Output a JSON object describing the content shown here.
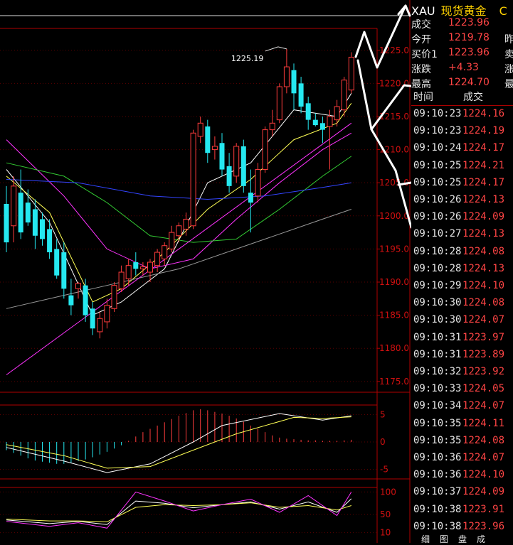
{
  "quote": {
    "symbol": "XAU",
    "name": "现货黄金",
    "extra": "C",
    "rows": [
      {
        "label": "成交",
        "value": "1223.96",
        "right": ""
      },
      {
        "label": "今开",
        "value": "1219.78",
        "right": "昨"
      },
      {
        "label": "买价1",
        "value": "1223.96",
        "right": "卖"
      },
      {
        "label": "涨跌",
        "value": "+4.33",
        "right": "涨"
      },
      {
        "label": "最高",
        "value": "1224.70",
        "right": "最"
      }
    ]
  },
  "ticks": {
    "col_time": "时间",
    "col_price": "成交",
    "rows": [
      {
        "time": "09:10:23",
        "price": "1224.16"
      },
      {
        "time": "09:10:23",
        "price": "1224.19"
      },
      {
        "time": "09:10:24",
        "price": "1224.17"
      },
      {
        "time": "09:10:25",
        "price": "1224.21"
      },
      {
        "time": "09:10:25",
        "price": "1224.17"
      },
      {
        "time": "09:10:26",
        "price": "1224.13"
      },
      {
        "time": "09:10:26",
        "price": "1224.09"
      },
      {
        "time": "09:10:27",
        "price": "1224.13"
      },
      {
        "time": "09:10:28",
        "price": "1224.08"
      },
      {
        "time": "09:10:28",
        "price": "1224.13"
      },
      {
        "time": "09:10:29",
        "price": "1224.10"
      },
      {
        "time": "09:10:30",
        "price": "1224.08"
      },
      {
        "time": "09:10:30",
        "price": "1224.07"
      },
      {
        "time": "09:10:31",
        "price": "1223.97"
      },
      {
        "time": "09:10:31",
        "price": "1223.89"
      },
      {
        "time": "09:10:32",
        "price": "1223.92"
      },
      {
        "time": "09:10:33",
        "price": "1224.05"
      },
      {
        "time": "09:10:34",
        "price": "1224.07"
      },
      {
        "time": "09:10:35",
        "price": "1224.11"
      },
      {
        "time": "09:10:35",
        "price": "1224.08"
      },
      {
        "time": "09:10:36",
        "price": "1224.07"
      },
      {
        "time": "09:10:36",
        "price": "1224.10"
      },
      {
        "time": "09:10:37",
        "price": "1224.09"
      },
      {
        "time": "09:10:38",
        "price": "1223.91"
      },
      {
        "time": "09:10:38",
        "price": "1223.96"
      }
    ],
    "tabs": [
      "细",
      "图",
      "盘",
      "成"
    ]
  },
  "colors": {
    "up": "#ff3c3c",
    "down": "#25e8f0",
    "axis": "#b00000",
    "ma_white": "#ffffff",
    "ma_yellow": "#ffff55",
    "ma_magenta": "#ff33ff",
    "ma_green": "#33cc33",
    "ma_blue": "#3344ff",
    "ma_gray": "#999999"
  },
  "chart_data": {
    "type": "candlestick",
    "price_axis": {
      "ticks": [
        "1225.0",
        "1220.0",
        "1215.0",
        "1210.0",
        "1205.0",
        "1200.0",
        "1195.0",
        "1190.0",
        "1185.0",
        "1180.0",
        "1175.0"
      ],
      "range": [
        1173.8,
        1228.3
      ]
    },
    "high_annotation": "1225.19",
    "candles": [
      {
        "o": 1201.8,
        "h": 1204.5,
        "l": 1194.5,
        "c": 1196.0
      },
      {
        "o": 1198.5,
        "h": 1206.0,
        "l": 1196.0,
        "c": 1204.5
      },
      {
        "o": 1203.5,
        "h": 1207.0,
        "l": 1196.5,
        "c": 1197.5
      },
      {
        "o": 1202.0,
        "h": 1204.0,
        "l": 1198.5,
        "c": 1199.0
      },
      {
        "o": 1201.0,
        "h": 1202.5,
        "l": 1195.0,
        "c": 1197.0
      },
      {
        "o": 1199.5,
        "h": 1200.5,
        "l": 1195.5,
        "c": 1196.5
      },
      {
        "o": 1198.0,
        "h": 1199.5,
        "l": 1193.5,
        "c": 1194.5
      },
      {
        "o": 1195.0,
        "h": 1196.5,
        "l": 1190.5,
        "c": 1191.0
      },
      {
        "o": 1194.5,
        "h": 1196.0,
        "l": 1187.5,
        "c": 1189.0
      },
      {
        "o": 1188.0,
        "h": 1190.5,
        "l": 1185.0,
        "c": 1186.5
      },
      {
        "o": 1189.0,
        "h": 1190.0,
        "l": 1187.5,
        "c": 1189.8
      },
      {
        "o": 1189.5,
        "h": 1190.5,
        "l": 1184.0,
        "c": 1185.0
      },
      {
        "o": 1186.0,
        "h": 1187.0,
        "l": 1182.0,
        "c": 1183.0
      },
      {
        "o": 1182.5,
        "h": 1185.5,
        "l": 1181.5,
        "c": 1184.5
      },
      {
        "o": 1184.0,
        "h": 1187.5,
        "l": 1183.0,
        "c": 1186.5
      },
      {
        "o": 1186.0,
        "h": 1190.0,
        "l": 1185.5,
        "c": 1189.5
      },
      {
        "o": 1189.0,
        "h": 1192.5,
        "l": 1188.5,
        "c": 1191.5
      },
      {
        "o": 1190.5,
        "h": 1193.5,
        "l": 1189.5,
        "c": 1192.5
      },
      {
        "o": 1193.0,
        "h": 1194.5,
        "l": 1191.0,
        "c": 1192.0
      },
      {
        "o": 1192.0,
        "h": 1193.0,
        "l": 1191.0,
        "c": 1192.3
      },
      {
        "o": 1191.5,
        "h": 1193.5,
        "l": 1190.0,
        "c": 1193.0
      },
      {
        "o": 1192.5,
        "h": 1195.0,
        "l": 1191.5,
        "c": 1194.5
      },
      {
        "o": 1193.5,
        "h": 1196.0,
        "l": 1192.5,
        "c": 1195.5
      },
      {
        "o": 1195.0,
        "h": 1198.5,
        "l": 1194.5,
        "c": 1197.5
      },
      {
        "o": 1197.0,
        "h": 1199.0,
        "l": 1196.0,
        "c": 1198.5
      },
      {
        "o": 1198.0,
        "h": 1200.5,
        "l": 1197.0,
        "c": 1199.5
      },
      {
        "o": 1198.5,
        "h": 1213.0,
        "l": 1198.0,
        "c": 1212.5
      },
      {
        "o": 1212.0,
        "h": 1215.0,
        "l": 1211.0,
        "c": 1214.0
      },
      {
        "o": 1213.5,
        "h": 1214.5,
        "l": 1208.0,
        "c": 1209.5
      },
      {
        "o": 1210.0,
        "h": 1212.0,
        "l": 1208.5,
        "c": 1210.5
      },
      {
        "o": 1211.0,
        "h": 1212.5,
        "l": 1206.0,
        "c": 1207.0
      },
      {
        "o": 1207.5,
        "h": 1209.5,
        "l": 1203.5,
        "c": 1204.5
      },
      {
        "o": 1206.0,
        "h": 1211.0,
        "l": 1205.0,
        "c": 1210.5
      },
      {
        "o": 1210.5,
        "h": 1211.5,
        "l": 1203.5,
        "c": 1204.5
      },
      {
        "o": 1203.5,
        "h": 1207.0,
        "l": 1197.5,
        "c": 1202.0
      },
      {
        "o": 1203.0,
        "h": 1208.0,
        "l": 1202.0,
        "c": 1207.0
      },
      {
        "o": 1207.0,
        "h": 1213.5,
        "l": 1206.5,
        "c": 1213.0
      },
      {
        "o": 1213.0,
        "h": 1216.0,
        "l": 1212.0,
        "c": 1214.0
      },
      {
        "o": 1214.5,
        "h": 1220.0,
        "l": 1214.0,
        "c": 1219.5
      },
      {
        "o": 1219.5,
        "h": 1225.2,
        "l": 1218.5,
        "c": 1222.5
      },
      {
        "o": 1222.0,
        "h": 1223.0,
        "l": 1216.0,
        "c": 1218.5
      },
      {
        "o": 1220.0,
        "h": 1221.0,
        "l": 1215.5,
        "c": 1216.5
      },
      {
        "o": 1217.0,
        "h": 1218.0,
        "l": 1213.0,
        "c": 1214.5
      },
      {
        "o": 1214.5,
        "h": 1215.5,
        "l": 1213.5,
        "c": 1213.7
      },
      {
        "o": 1214.0,
        "h": 1215.0,
        "l": 1211.0,
        "c": 1213.0
      },
      {
        "o": 1213.5,
        "h": 1216.0,
        "l": 1207.0,
        "c": 1215.0
      },
      {
        "o": 1214.5,
        "h": 1217.5,
        "l": 1213.5,
        "c": 1216.5
      },
      {
        "o": 1216.0,
        "h": 1221.0,
        "l": 1215.0,
        "c": 1220.5
      },
      {
        "o": 1219.0,
        "h": 1224.7,
        "l": 1218.5,
        "c": 1223.96
      }
    ],
    "moving_averages": [
      {
        "color": "ma_white",
        "values": [
          [
            0,
            1207.0
          ],
          [
            6,
            1199.0
          ],
          [
            12,
            1185.0
          ],
          [
            16,
            1187.0
          ],
          [
            22,
            1192.0
          ],
          [
            28,
            1205.0
          ],
          [
            34,
            1208.0
          ],
          [
            40,
            1216.0
          ],
          [
            46,
            1215.0
          ],
          [
            48,
            1218.5
          ]
        ]
      },
      {
        "color": "ma_yellow",
        "values": [
          [
            0,
            1206.0
          ],
          [
            6,
            1200.5
          ],
          [
            12,
            1187.0
          ],
          [
            16,
            1189.0
          ],
          [
            22,
            1194.5
          ],
          [
            28,
            1201.0
          ],
          [
            34,
            1205.5
          ],
          [
            40,
            1211.5
          ],
          [
            46,
            1214.0
          ],
          [
            48,
            1217.0
          ]
        ]
      },
      {
        "color": "ma_magenta",
        "values": [
          [
            0,
            1211.5
          ],
          [
            8,
            1203.0
          ],
          [
            14,
            1195.0
          ],
          [
            20,
            1192.0
          ],
          [
            26,
            1193.5
          ],
          [
            32,
            1199.5
          ],
          [
            38,
            1205.0
          ],
          [
            44,
            1210.0
          ],
          [
            48,
            1212.5
          ]
        ]
      },
      {
        "color": "ma_green",
        "values": [
          [
            0,
            1208.0
          ],
          [
            8,
            1206.0
          ],
          [
            14,
            1202.0
          ],
          [
            20,
            1197.0
          ],
          [
            26,
            1196.0
          ],
          [
            32,
            1196.5
          ],
          [
            38,
            1201.0
          ],
          [
            44,
            1206.0
          ],
          [
            48,
            1209.0
          ]
        ]
      },
      {
        "color": "ma_blue",
        "values": [
          [
            0,
            1205.5
          ],
          [
            10,
            1205.0
          ],
          [
            20,
            1203.0
          ],
          [
            28,
            1202.5
          ],
          [
            36,
            1203.0
          ],
          [
            44,
            1204.3
          ],
          [
            48,
            1205.0
          ]
        ]
      },
      {
        "color": "ma_gray",
        "values": [
          [
            0,
            1186.0
          ],
          [
            12,
            1189.0
          ],
          [
            24,
            1192.0
          ],
          [
            36,
            1196.5
          ],
          [
            44,
            1199.5
          ],
          [
            48,
            1201.0
          ]
        ]
      }
    ],
    "trendline": {
      "from": [
        0,
        1176.0
      ],
      "to": [
        48,
        1214.0
      ]
    },
    "macd": {
      "ticks": [
        "5",
        "0",
        "-5"
      ],
      "range": [
        -6.5,
        6.5
      ],
      "bars": [
        -1.5,
        -2,
        -2.5,
        -3,
        -3.4,
        -3.6,
        -3.8,
        -4,
        -4,
        -3.8,
        -3.5,
        -3.2,
        -2.8,
        -2.3,
        -1.8,
        -1.2,
        -0.6,
        0.2,
        1,
        1.8,
        2.4,
        3,
        3.6,
        4.2,
        4.8,
        5.3,
        5.8,
        6,
        5.8,
        5.5,
        5.2,
        4.8,
        4.3,
        3.7,
        3,
        2.4,
        1.8,
        1.2,
        0.8,
        0.6,
        0.5,
        0.4,
        0.3,
        0.3,
        0.2,
        0.2,
        0.2,
        0.3,
        0.4
      ],
      "dif": [
        [
          0,
          -1
        ],
        [
          8,
          -3.5
        ],
        [
          14,
          -5.6
        ],
        [
          20,
          -4
        ],
        [
          26,
          0
        ],
        [
          30,
          3
        ],
        [
          38,
          5.2
        ],
        [
          44,
          4
        ],
        [
          48,
          4.8
        ]
      ],
      "dea": [
        [
          0,
          -0.5
        ],
        [
          8,
          -2.5
        ],
        [
          14,
          -4.8
        ],
        [
          20,
          -4.5
        ],
        [
          26,
          -1.5
        ],
        [
          32,
          1.5
        ],
        [
          40,
          4.5
        ],
        [
          44,
          4.3
        ],
        [
          48,
          4.6
        ]
      ]
    },
    "kdj": {
      "ticks": [
        "100",
        "50",
        "10"
      ],
      "range": [
        0,
        110
      ],
      "k": [
        [
          0,
          38
        ],
        [
          6,
          30
        ],
        [
          10,
          35
        ],
        [
          14,
          28
        ],
        [
          18,
          80
        ],
        [
          22,
          75
        ],
        [
          26,
          65
        ],
        [
          30,
          72
        ],
        [
          34,
          78
        ],
        [
          38,
          62
        ],
        [
          42,
          78
        ],
        [
          46,
          55
        ],
        [
          48,
          85
        ]
      ],
      "d": [
        [
          0,
          40
        ],
        [
          6,
          36
        ],
        [
          10,
          36
        ],
        [
          14,
          34
        ],
        [
          18,
          66
        ],
        [
          22,
          72
        ],
        [
          26,
          70
        ],
        [
          30,
          72
        ],
        [
          34,
          76
        ],
        [
          38,
          66
        ],
        [
          42,
          70
        ],
        [
          46,
          60
        ],
        [
          48,
          70
        ]
      ],
      "j": [
        [
          0,
          35
        ],
        [
          6,
          24
        ],
        [
          10,
          32
        ],
        [
          14,
          20
        ],
        [
          18,
          100
        ],
        [
          22,
          80
        ],
        [
          26,
          58
        ],
        [
          30,
          72
        ],
        [
          34,
          84
        ],
        [
          38,
          55
        ],
        [
          42,
          92
        ],
        [
          46,
          48
        ],
        [
          48,
          100
        ]
      ]
    }
  }
}
